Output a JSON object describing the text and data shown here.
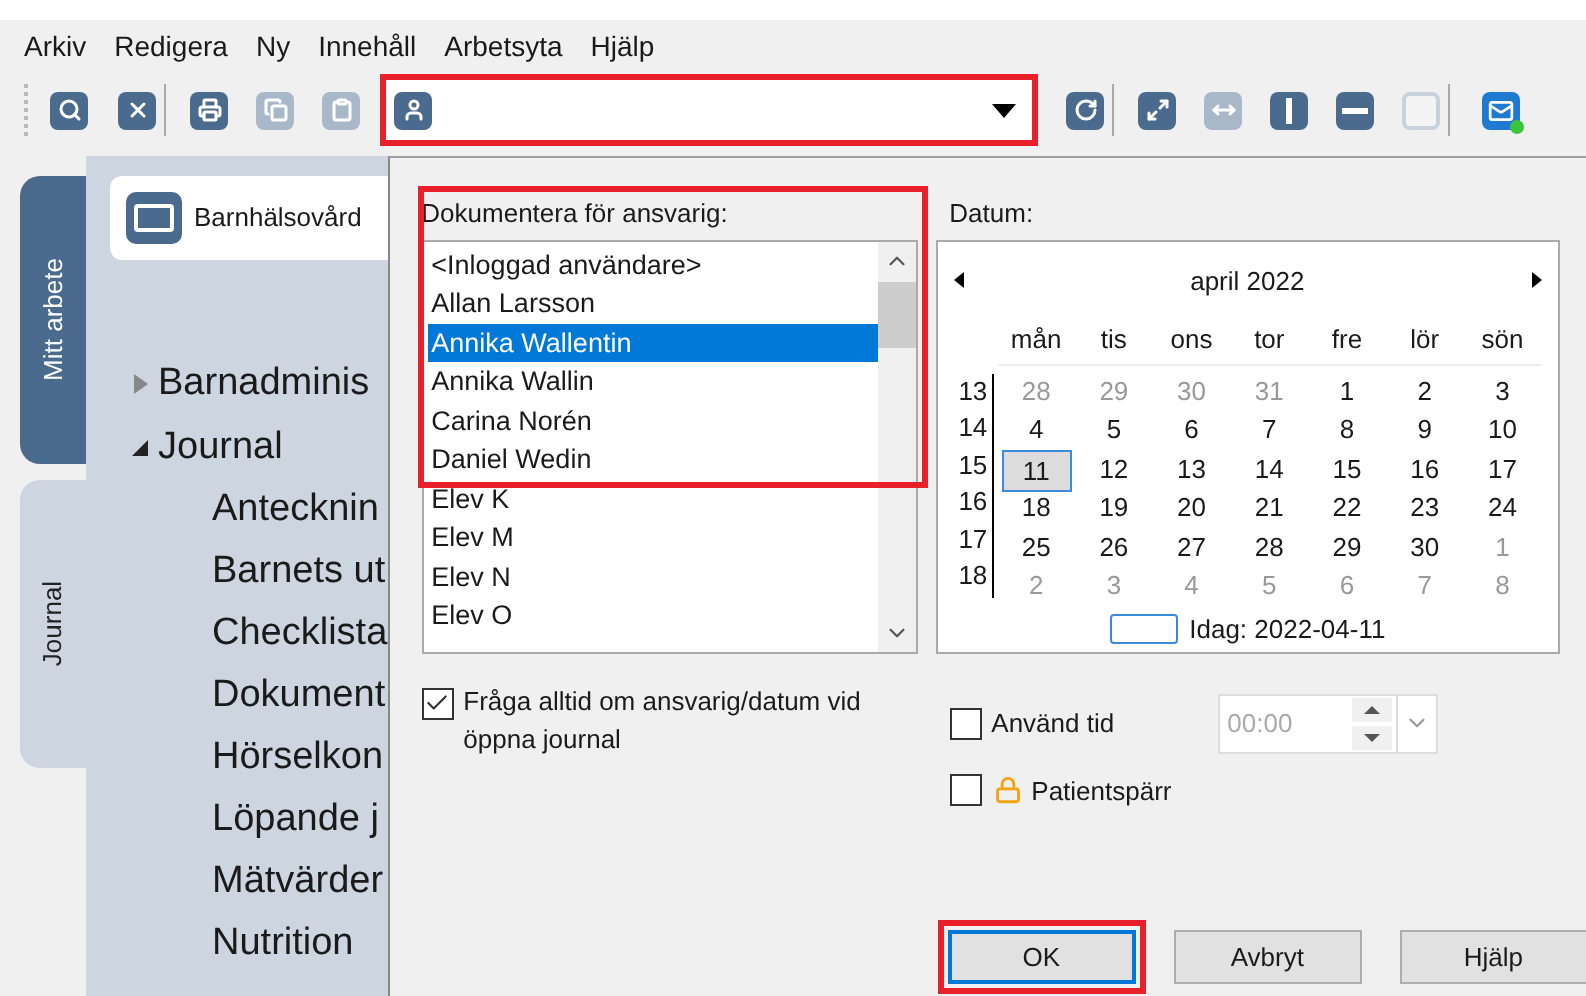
{
  "menu": [
    {
      "label": "Arkiv"
    },
    {
      "label": "Redigera"
    },
    {
      "label": "Ny"
    },
    {
      "label": "Innehåll"
    },
    {
      "label": "Arbetsyta"
    },
    {
      "label": "Hjälp"
    }
  ],
  "toolbar": [
    {
      "disabled": false
    },
    {
      "disabled": false
    },
    {
      "disabled": false
    },
    {
      "disabled": true
    },
    {
      "disabled": true
    },
    {
      "disabled": false
    },
    {
      "disabled": false
    },
    {
      "disabled": true
    },
    {
      "disabled": false
    },
    {
      "disabled": false
    },
    {
      "disabled": true
    },
    {
      "disabled": false
    }
  ],
  "side_tabs": [
    {
      "label": "Mitt arbete",
      "selected": false
    },
    {
      "label": "Journal",
      "selected": true
    }
  ],
  "workspace": {
    "title": "Barnhälsovård"
  },
  "tree": [
    {
      "label": "Barnadminis",
      "expanded": false
    },
    {
      "label": "Journal",
      "expanded": true,
      "children": [
        {
          "label": "Antecknin"
        },
        {
          "label": "Barnets ut"
        },
        {
          "label": "Checklista"
        },
        {
          "label": "Dokument"
        },
        {
          "label": "Hörselkon"
        },
        {
          "label": "Löpande j"
        },
        {
          "label": "Mätvärder"
        },
        {
          "label": "Nutrition"
        }
      ]
    }
  ],
  "responsible": {
    "label": "Dokumentera för ansvarig:",
    "items": [
      {
        "label": "<Inloggad användare>",
        "selected": false
      },
      {
        "label": "Allan Larsson",
        "selected": false
      },
      {
        "label": "Annika Wallentin",
        "selected": true
      },
      {
        "label": "Annika Wallin",
        "selected": false
      },
      {
        "label": "Carina Norén",
        "selected": false
      },
      {
        "label": "Daniel Wedin",
        "selected": false
      },
      {
        "label": "Elev K",
        "selected": false
      },
      {
        "label": "Elev M",
        "selected": false
      },
      {
        "label": "Elev N",
        "selected": false
      },
      {
        "label": "Elev O",
        "selected": false
      }
    ]
  },
  "always_ask": {
    "label": "Fråga alltid om ansvarig/datum vid öppna journal",
    "checked": true
  },
  "date": {
    "label": "Datum:",
    "month": "april 2022",
    "weekdays": [
      "mån",
      "tis",
      "ons",
      "tor",
      "fre",
      "lör",
      "sön"
    ],
    "weeks": [
      {
        "week": "13",
        "days": [
          {
            "label": "28",
            "muted": true,
            "selected": false
          },
          {
            "label": "29",
            "muted": true,
            "selected": false
          },
          {
            "label": "30",
            "muted": true,
            "selected": false
          },
          {
            "label": "31",
            "muted": true,
            "selected": false
          },
          {
            "label": "1",
            "muted": false,
            "selected": false
          },
          {
            "label": "2",
            "muted": false,
            "selected": false
          },
          {
            "label": "3",
            "muted": false,
            "selected": false
          }
        ]
      },
      {
        "week": "14",
        "days": [
          {
            "label": "4",
            "muted": false,
            "selected": false
          },
          {
            "label": "5",
            "muted": false,
            "selected": false
          },
          {
            "label": "6",
            "muted": false,
            "selected": false
          },
          {
            "label": "7",
            "muted": false,
            "selected": false
          },
          {
            "label": "8",
            "muted": false,
            "selected": false
          },
          {
            "label": "9",
            "muted": false,
            "selected": false
          },
          {
            "label": "10",
            "muted": false,
            "selected": false
          }
        ]
      },
      {
        "week": "15",
        "days": [
          {
            "label": "11",
            "muted": false,
            "selected": true
          },
          {
            "label": "12",
            "muted": false,
            "selected": false
          },
          {
            "label": "13",
            "muted": false,
            "selected": false
          },
          {
            "label": "14",
            "muted": false,
            "selected": false
          },
          {
            "label": "15",
            "muted": false,
            "selected": false
          },
          {
            "label": "16",
            "muted": false,
            "selected": false
          },
          {
            "label": "17",
            "muted": false,
            "selected": false
          }
        ]
      },
      {
        "week": "16",
        "days": [
          {
            "label": "18",
            "muted": false,
            "selected": false
          },
          {
            "label": "19",
            "muted": false,
            "selected": false
          },
          {
            "label": "20",
            "muted": false,
            "selected": false
          },
          {
            "label": "21",
            "muted": false,
            "selected": false
          },
          {
            "label": "22",
            "muted": false,
            "selected": false
          },
          {
            "label": "23",
            "muted": false,
            "selected": false
          },
          {
            "label": "24",
            "muted": false,
            "selected": false
          }
        ]
      },
      {
        "week": "17",
        "days": [
          {
            "label": "25",
            "muted": false,
            "selected": false
          },
          {
            "label": "26",
            "muted": false,
            "selected": false
          },
          {
            "label": "27",
            "muted": false,
            "selected": false
          },
          {
            "label": "28",
            "muted": false,
            "selected": false
          },
          {
            "label": "29",
            "muted": false,
            "selected": false
          },
          {
            "label": "30",
            "muted": false,
            "selected": false
          },
          {
            "label": "1",
            "muted": true,
            "selected": false
          }
        ]
      },
      {
        "week": "18",
        "days": [
          {
            "label": "2",
            "muted": true,
            "selected": false
          },
          {
            "label": "3",
            "muted": true,
            "selected": false
          },
          {
            "label": "4",
            "muted": true,
            "selected": false
          },
          {
            "label": "5",
            "muted": true,
            "selected": false
          },
          {
            "label": "6",
            "muted": true,
            "selected": false
          },
          {
            "label": "7",
            "muted": true,
            "selected": false
          },
          {
            "label": "8",
            "muted": true,
            "selected": false
          }
        ]
      }
    ],
    "today": "Idag: 2022-04-11"
  },
  "use_time": {
    "label": "Använd tid",
    "checked": false,
    "value": "00:00"
  },
  "patient_lock": {
    "label": "Patientspärr",
    "checked": false
  },
  "buttons": [
    {
      "label": "OK",
      "default": true
    },
    {
      "label": "Avbryt",
      "default": false
    },
    {
      "label": "Hjälp",
      "default": false
    }
  ]
}
